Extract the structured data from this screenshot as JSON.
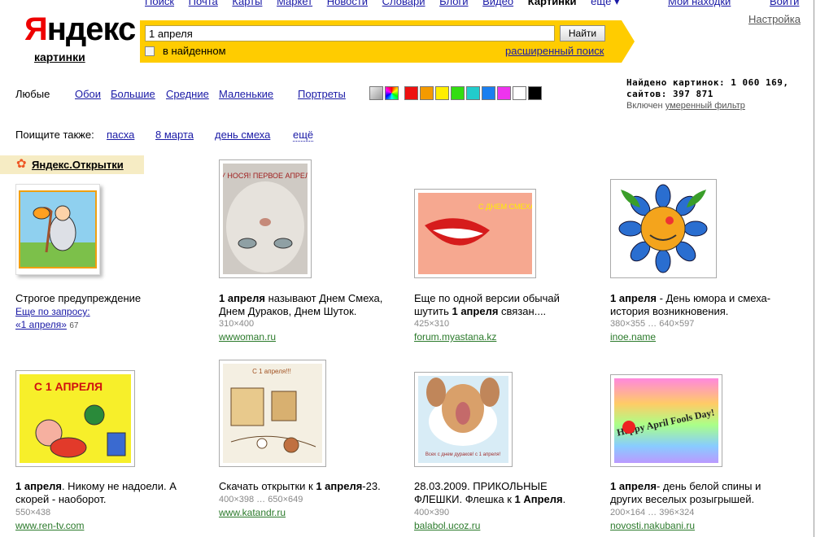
{
  "topnav": {
    "items": [
      "Поиск",
      "Почта",
      "Карты",
      "Маркет",
      "Новости",
      "Словари",
      "Блоги",
      "Видео"
    ],
    "current": "Картинки",
    "more": "ещё ▾",
    "mine": "Мои находки",
    "login": "Войти",
    "settings": "Настройка"
  },
  "logo": {
    "brand_first": "Я",
    "brand_rest": "ндекс",
    "service": "картинки"
  },
  "search": {
    "query": "1 апреля",
    "submit_label": "Найти",
    "in_found_label": "в найденном",
    "advanced_label": "расширенный поиск"
  },
  "filters": {
    "size_any": "Любые",
    "wallpapers": "Обои",
    "large": "Большие",
    "medium": "Средние",
    "small": "Маленькие",
    "portraits": "Портреты",
    "colors": [
      "#c8c8c8",
      "multicolor",
      "#ee1111",
      "#f49a00",
      "#ffee00",
      "#33dd11",
      "#22cccc",
      "#1a7ff0",
      "#ee33ee",
      "#ffffff",
      "#000000"
    ]
  },
  "stats": {
    "found_label": "Найдено картинок:",
    "found_count": "1 060 169,",
    "sites_label": "сайтов:",
    "sites_count": "397 871",
    "filter_prefix": "Включен",
    "filter_link": "умеренный фильтр"
  },
  "also": {
    "label": "Поищите также:",
    "items": [
      "пасха",
      "8 марта",
      "день смеха"
    ],
    "more": "ещё"
  },
  "cards": {
    "title": "Яндекс.Открытки",
    "caption": "Строгое предупреждение",
    "more_label": "Еще по запросу:",
    "query_link": "«1 апреля»",
    "query_count": "67"
  },
  "results": [
    {
      "cap_b": "1 апреля",
      "cap": " называют Днем Смеха, Днем Дураков, Днем Шуток.",
      "dims": "310×400",
      "host": "wwwoman.ru"
    },
    {
      "cap_pre": "Еще по одной версии обычай шутить ",
      "cap_b": "1 апреля",
      "cap": " связан....",
      "dims": "425×310",
      "host": "forum.myastana.kz"
    },
    {
      "cap_b": "1 апреля",
      "cap": " - День юмора и смеха- история возникновения.",
      "dims": "380×355 … 640×597",
      "host": "inoe.name"
    },
    {
      "cap_b": "1 апреля",
      "cap": ". Никому не надоели. А скорей - наоборот.",
      "dims": "550×438",
      "host": "www.ren-tv.com"
    },
    {
      "cap_pre": "Скачать открытки к ",
      "cap_b": "1 апреля",
      "cap": "-23.",
      "dims": "400×398 … 650×649",
      "host": "www.katandr.ru"
    },
    {
      "cap_pre": "28.03.2009. ПРИКОЛЬНЫЕ ФЛЕШКИ. Флешка к ",
      "cap_b": "1 Апреля",
      "cap": ".",
      "dims": "400×390",
      "host": "balabol.ucoz.ru"
    },
    {
      "cap_b": "1 апреля",
      "cap": "- день белой спины и других веселых розыгрышей.",
      "dims": "200×164 … 396×324",
      "host": "novosti.nakubani.ru"
    }
  ],
  "image_text": {
    "r1": "НУ НОСЯ! ПЕРВОЕ АПРЕЛЯ",
    "r2": "С ДНЕМ СМЕХА!",
    "r4": "С 1 АПРЕЛЯ",
    "r5": "С 1 апреля!!!",
    "r6": "Всех с днем дураков! с 1 апреля!",
    "r7": "Happy April Fools Day!"
  }
}
